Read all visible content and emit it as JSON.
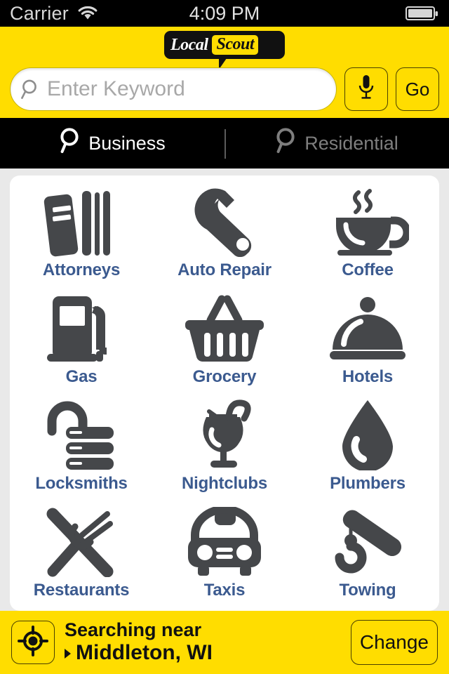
{
  "statusbar": {
    "carrier": "Carrier",
    "time": "4:09 PM",
    "wifi_icon": "wifi-icon",
    "battery_icon": "battery-icon"
  },
  "header": {
    "logo_first": "Local",
    "logo_second": "Scout",
    "search": {
      "value": "",
      "placeholder": "Enter Keyword",
      "search_icon": "search-icon"
    },
    "mic_icon": "microphone-icon",
    "go_label": "Go"
  },
  "tabs": [
    {
      "label": "Business",
      "icon": "search-icon",
      "active": true
    },
    {
      "label": "Residential",
      "icon": "search-icon",
      "active": false
    }
  ],
  "categories": [
    {
      "label": "Attorneys",
      "icon": "law-books-icon"
    },
    {
      "label": "Auto Repair",
      "icon": "wrench-icon"
    },
    {
      "label": "Coffee",
      "icon": "coffee-cup-icon"
    },
    {
      "label": "Gas",
      "icon": "gas-pump-icon"
    },
    {
      "label": "Grocery",
      "icon": "shopping-basket-icon"
    },
    {
      "label": "Hotels",
      "icon": "serving-dome-icon"
    },
    {
      "label": "Locksmiths",
      "icon": "padlock-key-icon"
    },
    {
      "label": "Nightclubs",
      "icon": "cocktail-glass-icon"
    },
    {
      "label": "Plumbers",
      "icon": "water-drop-icon"
    },
    {
      "label": "Restaurants",
      "icon": "knife-fork-icon"
    },
    {
      "label": "Taxis",
      "icon": "taxi-car-icon"
    },
    {
      "label": "Towing",
      "icon": "tow-hook-icon"
    }
  ],
  "footer": {
    "locate_icon": "location-crosshair-icon",
    "searching_label": "Searching near",
    "city": "Middleton, WI",
    "change_label": "Change"
  },
  "colors": {
    "brand_yellow": "#ffdd00",
    "bar_black": "#000000",
    "label_blue": "#3b5a8f",
    "icon_gray": "#45474a"
  }
}
